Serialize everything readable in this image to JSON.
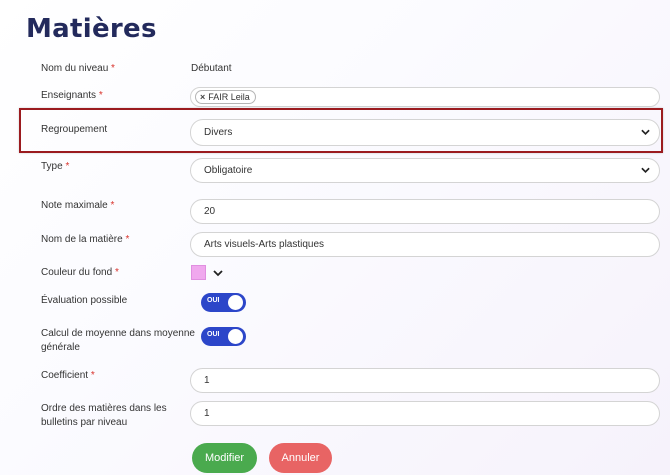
{
  "page": {
    "title": "Matières"
  },
  "form": {
    "niveau": {
      "label": "Nom du niveau",
      "required": "*",
      "value": "Débutant"
    },
    "enseignants": {
      "label": "Enseignants",
      "required": "*",
      "tags": [
        "FAIR Leila"
      ],
      "remove_glyph": "×"
    },
    "regroupement": {
      "label": "Regroupement",
      "value": "Divers"
    },
    "type": {
      "label": "Type",
      "required": "*",
      "value": "Obligatoire"
    },
    "note_max": {
      "label": "Note maximale",
      "required": "*",
      "value": "20"
    },
    "nom_matiere": {
      "label": "Nom de la matière",
      "required": "*",
      "value": "Arts visuels-Arts plastiques"
    },
    "couleur": {
      "label": "Couleur du fond",
      "required": "*",
      "value": "#f0a8ee"
    },
    "evaluation": {
      "label": "Évaluation possible",
      "toggle_text": "OUI",
      "on": true
    },
    "calcul": {
      "label_line1": "Calcul de moyenne dans moyenne",
      "label_line2": "générale",
      "toggle_text": "OUI",
      "on": true
    },
    "coefficient": {
      "label": "Coefficient",
      "required": "*",
      "value": "1"
    },
    "ordre": {
      "label_line1": "Ordre des matières dans les",
      "label_line2": "bulletins par niveau",
      "value": "1"
    }
  },
  "buttons": {
    "modifier": "Modifier",
    "annuler": "Annuler"
  },
  "colors": {
    "accent": "#2c46c9",
    "title": "#232a5c",
    "success": "#4aaa4e",
    "danger": "#e86464",
    "highlight": "#9b1b1f"
  },
  "icons": {
    "select": "chevron-down-icon",
    "remove": "close-icon"
  }
}
